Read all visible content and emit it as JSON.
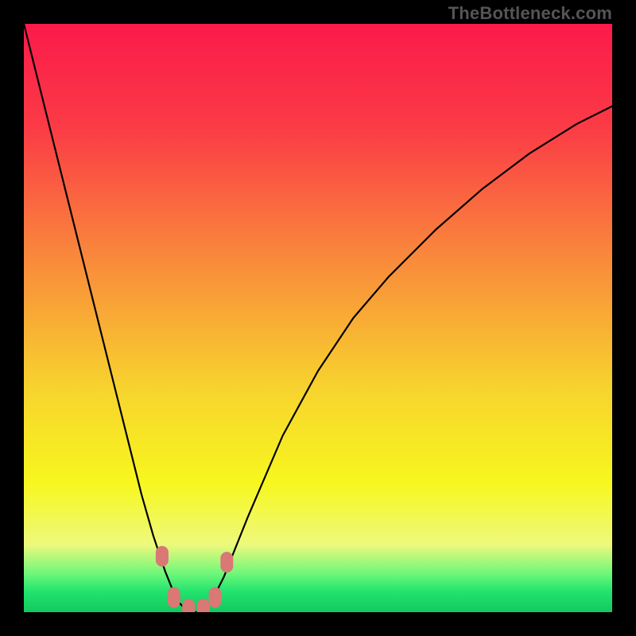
{
  "watermark": "TheBottleneck.com",
  "colors": {
    "frame": "#000000",
    "curve": "#000000",
    "marker": "#d97874",
    "gradient_stops": [
      {
        "offset": 0.0,
        "color": "#fb1a4a"
      },
      {
        "offset": 0.18,
        "color": "#fb3c46"
      },
      {
        "offset": 0.4,
        "color": "#f98a3b"
      },
      {
        "offset": 0.62,
        "color": "#f7d32e"
      },
      {
        "offset": 0.78,
        "color": "#f7f71e"
      },
      {
        "offset": 0.885,
        "color": "#eef97c"
      },
      {
        "offset": 0.935,
        "color": "#6df77a"
      },
      {
        "offset": 0.965,
        "color": "#22e36e"
      },
      {
        "offset": 1.0,
        "color": "#12c95f"
      }
    ]
  },
  "chart_data": {
    "type": "line",
    "title": "",
    "xlabel": "",
    "ylabel": "",
    "x": [
      0.0,
      0.02,
      0.04,
      0.06,
      0.08,
      0.1,
      0.12,
      0.14,
      0.16,
      0.18,
      0.2,
      0.22,
      0.24,
      0.26,
      0.28,
      0.3,
      0.32,
      0.34,
      0.38,
      0.44,
      0.5,
      0.56,
      0.62,
      0.7,
      0.78,
      0.86,
      0.94,
      1.0
    ],
    "y": [
      1.0,
      0.92,
      0.84,
      0.76,
      0.68,
      0.6,
      0.52,
      0.44,
      0.36,
      0.28,
      0.2,
      0.13,
      0.07,
      0.02,
      0.0,
      0.0,
      0.02,
      0.06,
      0.16,
      0.3,
      0.41,
      0.5,
      0.57,
      0.65,
      0.72,
      0.78,
      0.83,
      0.86
    ],
    "xlim": [
      0,
      1
    ],
    "ylim": [
      0,
      1
    ],
    "markers": [
      {
        "x": 0.235,
        "y": 0.095
      },
      {
        "x": 0.255,
        "y": 0.025
      },
      {
        "x": 0.28,
        "y": 0.005
      },
      {
        "x": 0.305,
        "y": 0.005
      },
      {
        "x": 0.325,
        "y": 0.025
      },
      {
        "x": 0.345,
        "y": 0.085
      }
    ]
  }
}
